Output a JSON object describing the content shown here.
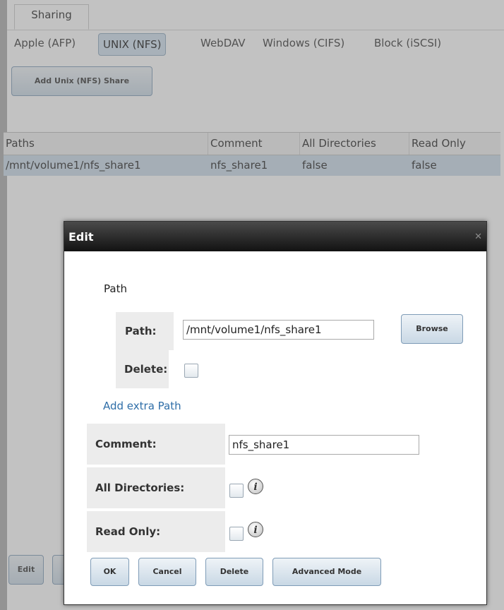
{
  "tabs": {
    "main": "Sharing"
  },
  "subtabs": [
    "Apple (AFP)",
    "UNIX (NFS)",
    "WebDAV",
    "Windows (CIFS)",
    "Block (iSCSI)"
  ],
  "subtabs_active": "UNIX (NFS)",
  "toolbar": {
    "add_label": "Add Unix (NFS) Share"
  },
  "grid": {
    "columns": [
      "Paths",
      "Comment",
      "All Directories",
      "Read Only"
    ],
    "rows": [
      [
        "/mnt/volume1/nfs_share1",
        "nfs_share1",
        "false",
        "false"
      ]
    ]
  },
  "bottom": {
    "edit_label": "Edit"
  },
  "dialog": {
    "title": "Edit",
    "close_icon": "close-icon",
    "path_legend": "Path",
    "path_label": "Path:",
    "path_value": "/mnt/volume1/nfs_share1",
    "browse_label": "Browse",
    "delete_label": "Delete:",
    "add_path_label": "Add extra Path",
    "comment_label": "Comment:",
    "comment_value": "nfs_share1",
    "all_dirs_label": "All Directories:",
    "read_only_label": "Read Only:",
    "info_icon": "i",
    "buttons": {
      "ok": "OK",
      "cancel": "Cancel",
      "delete": "Delete",
      "advanced": "Advanced Mode"
    }
  },
  "colors": {
    "accent": "#2f6ea8",
    "selected_row": "#cbdbe9",
    "dialog_header": "#1e1e1e"
  }
}
